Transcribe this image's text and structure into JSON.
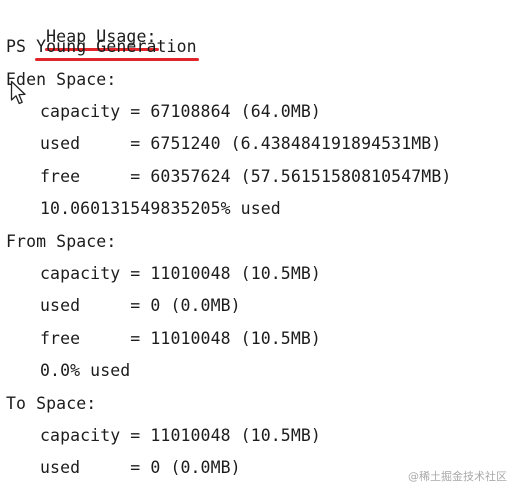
{
  "heap_usage": {
    "title": "Heap Usage:",
    "gen_prefix": "PS ",
    "gen_name": "Young Generation"
  },
  "eden": {
    "title": "Eden Space:",
    "capacity": "capacity = 67108864 (64.0MB)",
    "used": "used     = 6751240 (6.438484191894531MB)",
    "free": "free     = 60357624 (57.56151580810547MB)",
    "percent": "10.060131549835205% used"
  },
  "from": {
    "title": "From Space:",
    "capacity": "capacity = 11010048 (10.5MB)",
    "used": "used     = 0 (0.0MB)",
    "free": "free     = 11010048 (10.5MB)",
    "percent": "0.0% used"
  },
  "to": {
    "title": "To Space:",
    "capacity": "capacity = 11010048 (10.5MB)",
    "used": "used     = 0 (0.0MB)"
  },
  "watermark": "@稀土掘金技术社区",
  "colors": {
    "underline": "#e0242a",
    "text": "#1c1c1c",
    "background": "#ffffff"
  }
}
